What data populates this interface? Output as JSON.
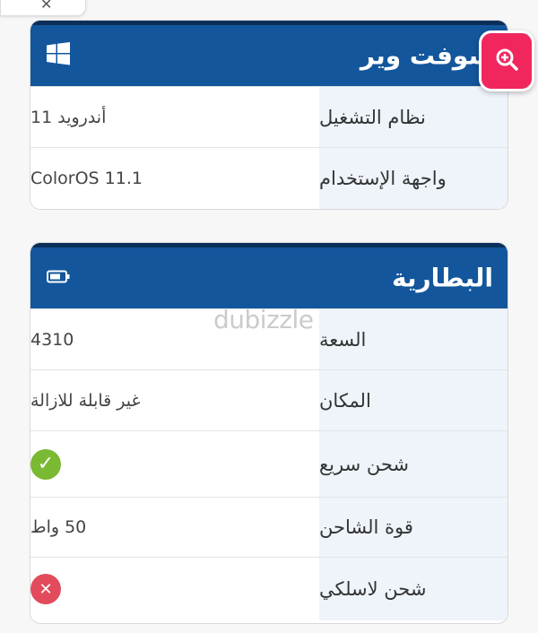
{
  "software_card": {
    "title": "سوفت وير",
    "icon": "windows-icon",
    "rows": [
      {
        "label": "نظام التشغيل",
        "value": "أندرويد 11"
      },
      {
        "label": "واجهة الإستخدام",
        "value": "ColorOS 11.1"
      }
    ]
  },
  "battery_card": {
    "title": "البطارية",
    "icon": "battery-icon",
    "rows": [
      {
        "label": "السعة",
        "value": "4310"
      },
      {
        "label": "المكان",
        "value": "غير قابلة للازالة"
      },
      {
        "label": "شحن سريع",
        "value": "",
        "status": "check-icon"
      },
      {
        "label": "قوة الشاحن",
        "value": "50 واط"
      },
      {
        "label": "شحن لاسلكي",
        "value": "",
        "status": "cross-icon"
      }
    ]
  },
  "watermark": "dubizzle",
  "zoom_button": {
    "icon": "zoom-in-icon"
  },
  "close_icon": "close-icon",
  "colors": {
    "header_blue": "#13569b",
    "label_bg": "#eef4fa",
    "check_green": "#7ab932",
    "cross_red": "#e14b5c",
    "zoom_pink": "#f0265d"
  }
}
